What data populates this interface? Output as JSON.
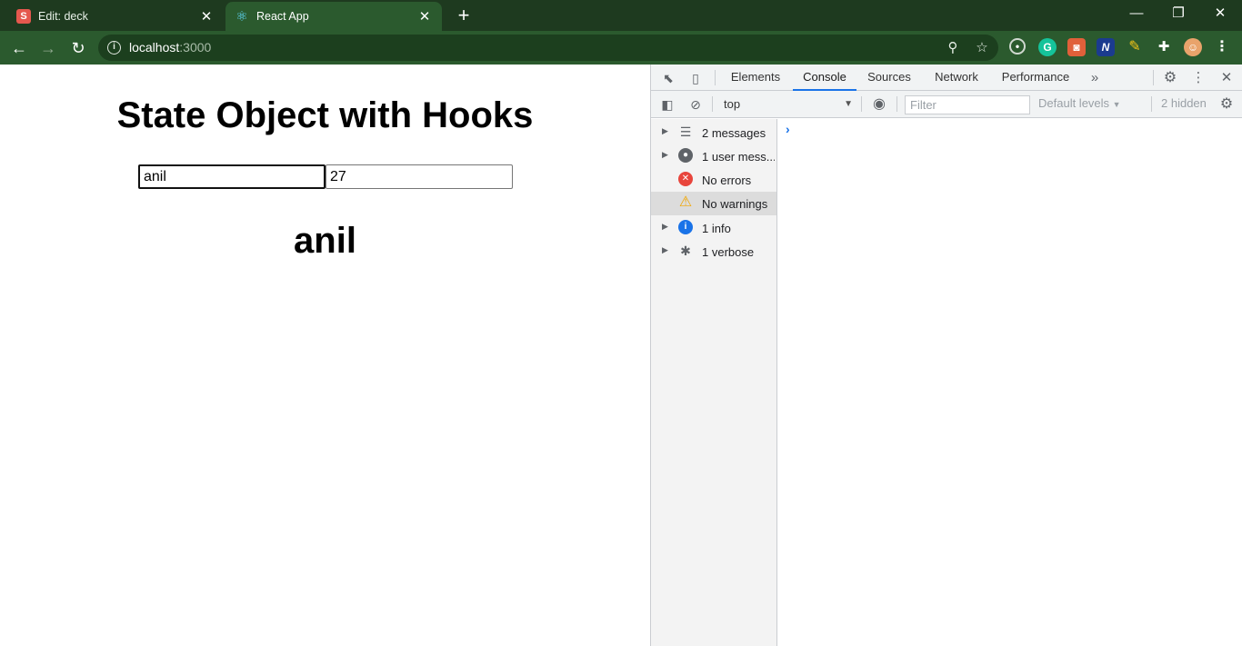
{
  "browser": {
    "tabs": [
      {
        "title": "Edit: deck",
        "icon": "s-favicon",
        "active": false
      },
      {
        "title": "React App",
        "icon": "react-favicon",
        "active": true
      }
    ],
    "address": {
      "host": "localhost",
      "port": ":3000"
    }
  },
  "page": {
    "heading": "State Object with Hooks",
    "name_value": "anil",
    "age_value": "27",
    "display_name": "anil"
  },
  "devtools": {
    "tabs": [
      "Elements",
      "Console",
      "Sources",
      "Network",
      "Performance"
    ],
    "active_tab": "Console",
    "context": "top",
    "filter_placeholder": "Filter",
    "levels": "Default levels",
    "hidden_count": "2 hidden",
    "sidebar": [
      {
        "label": "2 messages",
        "icon": "list-icon",
        "expandable": true
      },
      {
        "label": "1 user mess...",
        "icon": "user-icon",
        "expandable": true
      },
      {
        "label": "No errors",
        "icon": "error-icon",
        "expandable": false
      },
      {
        "label": "No warnings",
        "icon": "warning-icon",
        "expandable": false,
        "selected": true
      },
      {
        "label": "1 info",
        "icon": "info-icon",
        "expandable": true
      },
      {
        "label": "1 verbose",
        "icon": "bug-icon",
        "expandable": true
      }
    ]
  },
  "colors": {
    "chrome_dark": "#1e3a1f",
    "chrome": "#2b5a2e",
    "accent": "#1a73e8"
  }
}
